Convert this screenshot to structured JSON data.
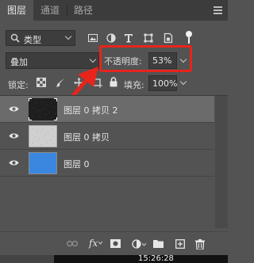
{
  "tabs": [
    {
      "label": "图层",
      "active": true
    },
    {
      "label": "通道",
      "active": false
    },
    {
      "label": "路径",
      "active": false
    }
  ],
  "filter": {
    "kind_label": "类型",
    "icons": [
      "image-filter-icon",
      "adjustment-filter-icon",
      "type-filter-icon",
      "shape-filter-icon",
      "smart-object-filter-icon",
      "filter-toggle-icon"
    ]
  },
  "blend": {
    "mode": "叠加",
    "opacity_label": "不透明度:",
    "opacity_value": "53%"
  },
  "lock": {
    "label": "锁定:",
    "fill_label": "填充:",
    "fill_value": "100%"
  },
  "layers": [
    {
      "name": "图层 0 拷贝 2",
      "visible": true,
      "selected": true,
      "thumb": "dark-noise"
    },
    {
      "name": "图层 0 拷贝",
      "visible": true,
      "selected": false,
      "thumb": "light-noise"
    },
    {
      "name": "图层 0",
      "visible": true,
      "selected": false,
      "thumb": "blue-fill"
    }
  ],
  "bottom_icons": [
    "link-icon",
    "fx-icon",
    "mask-icon",
    "adjustment-icon",
    "folder-icon",
    "new-layer-icon",
    "trash-icon"
  ],
  "taskbar": {
    "clock": "15:26:28"
  },
  "colors": {
    "panel": "#535353",
    "highlight": "#e8241c",
    "layer_blue": "#3b87e0"
  }
}
